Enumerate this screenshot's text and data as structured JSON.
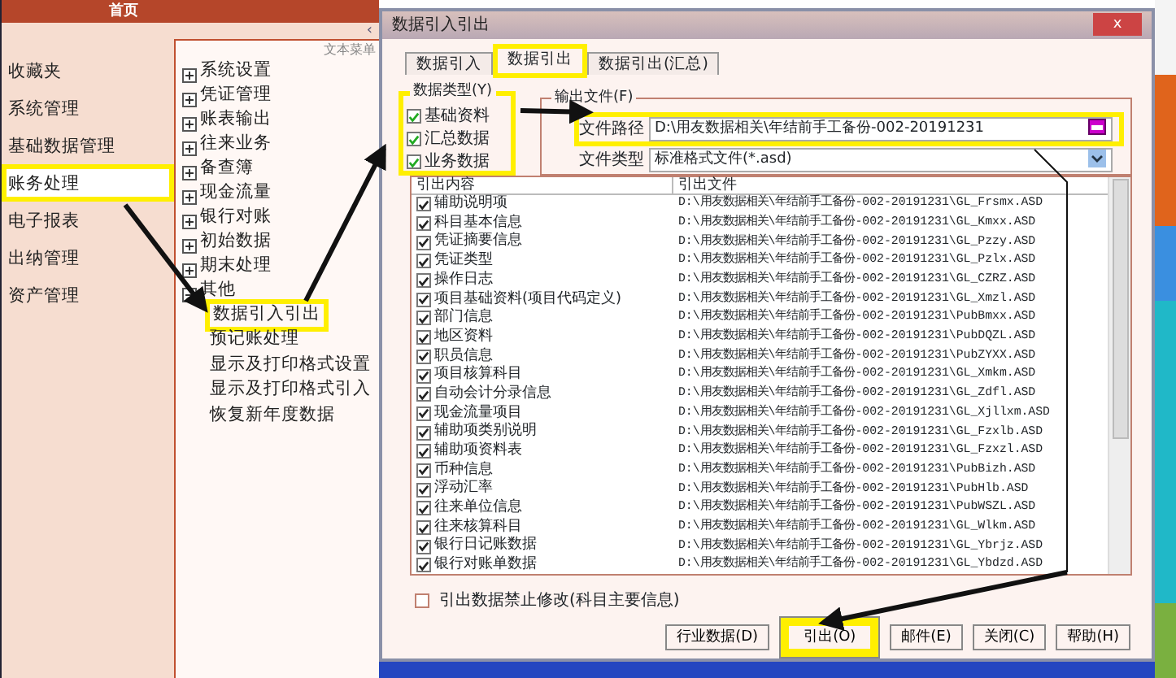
{
  "home_tab": {
    "title": "首页"
  },
  "collapse_glyph": "‹",
  "menu": [
    {
      "label": "收藏夹",
      "selected": false,
      "highlighted": false
    },
    {
      "label": "系统管理",
      "selected": false,
      "highlighted": false
    },
    {
      "label": "基础数据管理",
      "selected": false,
      "highlighted": false
    },
    {
      "label": "账务处理",
      "selected": true,
      "highlighted": true
    },
    {
      "label": "电子报表",
      "selected": false,
      "highlighted": false
    },
    {
      "label": "出纳管理",
      "selected": false,
      "highlighted": false
    },
    {
      "label": "资产管理",
      "selected": false,
      "highlighted": false
    }
  ],
  "tree": {
    "caption": "文本菜单",
    "items": [
      {
        "label": "系统设置",
        "expanded": false
      },
      {
        "label": "凭证管理",
        "expanded": false
      },
      {
        "label": "账表输出",
        "expanded": false
      },
      {
        "label": "往来业务",
        "expanded": false
      },
      {
        "label": "备查簿",
        "expanded": false
      },
      {
        "label": "现金流量",
        "expanded": false
      },
      {
        "label": "银行对账",
        "expanded": false
      },
      {
        "label": "初始数据",
        "expanded": false
      },
      {
        "label": "期末处理",
        "expanded": false
      },
      {
        "label": "其他",
        "expanded": true,
        "children": [
          {
            "label": "数据引入引出",
            "highlighted": true
          },
          {
            "label": "预记账处理",
            "highlighted": false
          },
          {
            "label": "显示及打印格式设置",
            "highlighted": false
          },
          {
            "label": "显示及打印格式引入",
            "highlighted": false
          },
          {
            "label": "恢复新年度数据",
            "highlighted": false
          }
        ]
      }
    ]
  },
  "dialog": {
    "title": "数据引入引出",
    "close": "x",
    "tabs": [
      {
        "label": "数据引入",
        "selected": false,
        "highlighted": false
      },
      {
        "label": "数据引出",
        "selected": true,
        "highlighted": true
      },
      {
        "label": "数据引出(汇总)",
        "selected": false,
        "highlighted": false
      }
    ],
    "data_type": {
      "legend": "数据类型(Y)",
      "highlighted": true,
      "options": [
        {
          "label": "基础资料",
          "checked": true
        },
        {
          "label": "汇总数据",
          "checked": true
        },
        {
          "label": "业务数据",
          "checked": true
        }
      ]
    },
    "output_file": {
      "legend": "输出文件(F)",
      "path_label": "文件路径",
      "path_value": "D:\\用友数据相关\\年结前手工备份-002-20191231",
      "path_highlighted": true,
      "type_label": "文件类型",
      "type_value": "标准格式文件(*.asd)"
    },
    "list": {
      "columns": [
        "引出内容",
        "引出文件"
      ],
      "rows": [
        {
          "content": "辅助说明项",
          "file": "D:\\用友数据相关\\年结前手工备份-002-20191231\\GL_Frsmx.ASD",
          "checked": true
        },
        {
          "content": "科目基本信息",
          "file": "D:\\用友数据相关\\年结前手工备份-002-20191231\\GL_Kmxx.ASD",
          "checked": true
        },
        {
          "content": "凭证摘要信息",
          "file": "D:\\用友数据相关\\年结前手工备份-002-20191231\\GL_Pzzy.ASD",
          "checked": true
        },
        {
          "content": "凭证类型",
          "file": "D:\\用友数据相关\\年结前手工备份-002-20191231\\GL_Pzlx.ASD",
          "checked": true
        },
        {
          "content": "操作日志",
          "file": "D:\\用友数据相关\\年结前手工备份-002-20191231\\GL_CZRZ.ASD",
          "checked": true
        },
        {
          "content": "项目基础资料(项目代码定义)",
          "file": "D:\\用友数据相关\\年结前手工备份-002-20191231\\GL_Xmzl.ASD",
          "checked": true
        },
        {
          "content": "部门信息",
          "file": "D:\\用友数据相关\\年结前手工备份-002-20191231\\PubBmxx.ASD",
          "checked": true
        },
        {
          "content": "地区资料",
          "file": "D:\\用友数据相关\\年结前手工备份-002-20191231\\PubDQZL.ASD",
          "checked": true
        },
        {
          "content": "职员信息",
          "file": "D:\\用友数据相关\\年结前手工备份-002-20191231\\PubZYXX.ASD",
          "checked": true
        },
        {
          "content": "项目核算科目",
          "file": "D:\\用友数据相关\\年结前手工备份-002-20191231\\GL_Xmkm.ASD",
          "checked": true
        },
        {
          "content": "自动会计分录信息",
          "file": "D:\\用友数据相关\\年结前手工备份-002-20191231\\GL_Zdfl.ASD",
          "checked": true
        },
        {
          "content": "现金流量项目",
          "file": "D:\\用友数据相关\\年结前手工备份-002-20191231\\GL_Xjllxm.ASD",
          "checked": true
        },
        {
          "content": "辅助项类别说明",
          "file": "D:\\用友数据相关\\年结前手工备份-002-20191231\\GL_Fzxlb.ASD",
          "checked": true
        },
        {
          "content": "辅助项资料表",
          "file": "D:\\用友数据相关\\年结前手工备份-002-20191231\\GL_Fzxzl.ASD",
          "checked": true
        },
        {
          "content": "币种信息",
          "file": "D:\\用友数据相关\\年结前手工备份-002-20191231\\PubBizh.ASD",
          "checked": true
        },
        {
          "content": "浮动汇率",
          "file": "D:\\用友数据相关\\年结前手工备份-002-20191231\\PubHlb.ASD",
          "checked": true
        },
        {
          "content": "往来单位信息",
          "file": "D:\\用友数据相关\\年结前手工备份-002-20191231\\PubWSZL.ASD",
          "checked": true
        },
        {
          "content": "往来核算科目",
          "file": "D:\\用友数据相关\\年结前手工备份-002-20191231\\GL_Wlkm.ASD",
          "checked": true
        },
        {
          "content": "银行日记账数据",
          "file": "D:\\用友数据相关\\年结前手工备份-002-20191231\\GL_Ybrjz.ASD",
          "checked": true
        },
        {
          "content": "银行对账单数据",
          "file": "D:\\用友数据相关\\年结前手工备份-002-20191231\\GL_Ybdzd.ASD",
          "checked": true
        }
      ]
    },
    "lock_option": {
      "label": "引出数据禁止修改(科目主要信息)",
      "checked": false
    },
    "buttons": [
      {
        "label": "行业数据(D)",
        "highlighted": false
      },
      {
        "label": "引出(O)",
        "highlighted": true
      },
      {
        "label": "邮件(E)",
        "highlighted": false
      },
      {
        "label": "关闭(C)",
        "highlighted": false
      },
      {
        "label": "帮助(H)",
        "highlighted": false
      }
    ]
  }
}
